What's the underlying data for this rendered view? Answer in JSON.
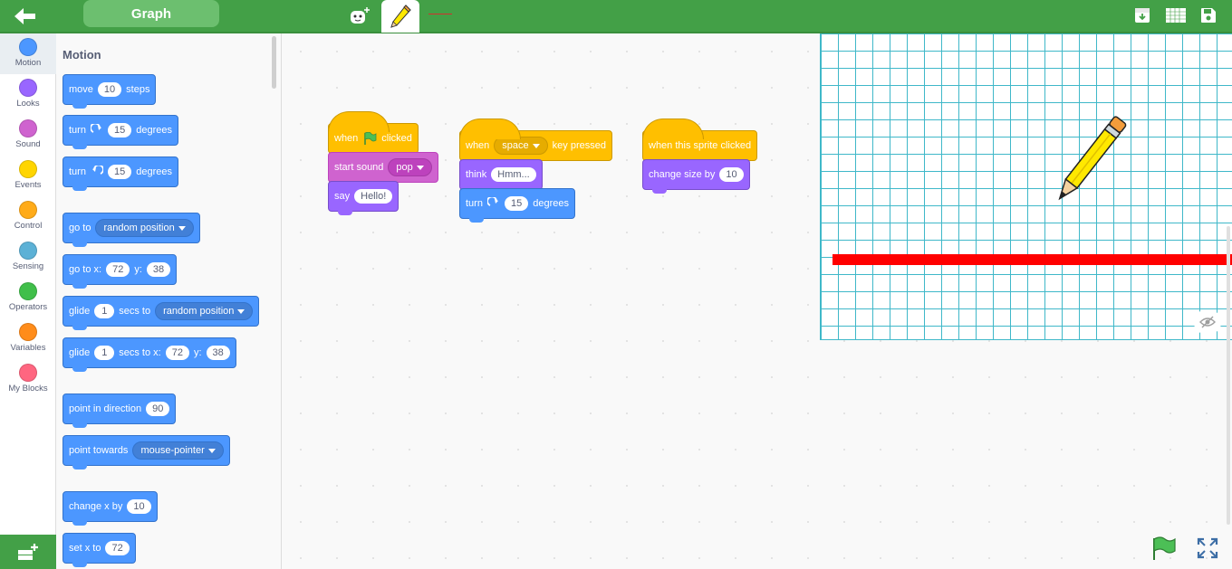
{
  "header": {
    "title": "Graph",
    "icons": [
      "back-arrow-icon",
      "sprite-add-icon",
      "pencil-tab-icon",
      "download-icon",
      "grid-icon",
      "save-icon"
    ]
  },
  "categories": [
    {
      "label": "Motion",
      "color": "#4c97ff"
    },
    {
      "label": "Looks",
      "color": "#9966ff"
    },
    {
      "label": "Sound",
      "color": "#cf63cf"
    },
    {
      "label": "Events",
      "color": "#ffd500"
    },
    {
      "label": "Control",
      "color": "#ffab19"
    },
    {
      "label": "Sensing",
      "color": "#5cb1d6"
    },
    {
      "label": "Operators",
      "color": "#40bf4a"
    },
    {
      "label": "Variables",
      "color": "#ff8c1a"
    },
    {
      "label": "My Blocks",
      "color": "#ff6680"
    }
  ],
  "palette": {
    "title": "Motion",
    "move": {
      "a": "move",
      "v": "10",
      "b": "steps"
    },
    "turn_right": {
      "a": "turn",
      "v": "15",
      "b": "degrees"
    },
    "turn_left": {
      "a": "turn",
      "v": "15",
      "b": "degrees"
    },
    "goto": {
      "a": "go to",
      "dd": "random position"
    },
    "goto_xy": {
      "a": "go to x:",
      "x": "72",
      "b": "y:",
      "y": "38"
    },
    "glide": {
      "a": "glide",
      "v": "1",
      "b": "secs to",
      "dd": "random position"
    },
    "glide_xy": {
      "a": "glide",
      "v": "1",
      "b": "secs to x:",
      "x": "72",
      "c": "y:",
      "y": "38"
    },
    "point_dir": {
      "a": "point in direction",
      "v": "90"
    },
    "point_towards": {
      "a": "point towards",
      "dd": "mouse-pointer"
    },
    "change_x": {
      "a": "change x by",
      "v": "10"
    },
    "set_x": {
      "a": "set x to",
      "v": "72"
    }
  },
  "scripts": {
    "s1": {
      "when": "when",
      "clicked": "clicked",
      "start_sound": "start sound",
      "sound": "pop",
      "say": "say",
      "say_val": "Hello!"
    },
    "s2": {
      "when": "when",
      "key": "space",
      "key_pressed": "key pressed",
      "think": "think",
      "think_val": "Hmm...",
      "turn": "turn",
      "turn_val": "15",
      "degrees": "degrees"
    },
    "s3": {
      "when_clicked": "when this sprite clicked",
      "change_size": "change size by",
      "size_val": "10"
    }
  },
  "colors": {
    "topbar": "#43a047",
    "motion": "#4c97ff",
    "events": "#ffbf00",
    "looks": "#9966ff",
    "sound": "#cf63cf",
    "stage_grid": "#3fb8c9",
    "pen_line": "#ff0000"
  }
}
